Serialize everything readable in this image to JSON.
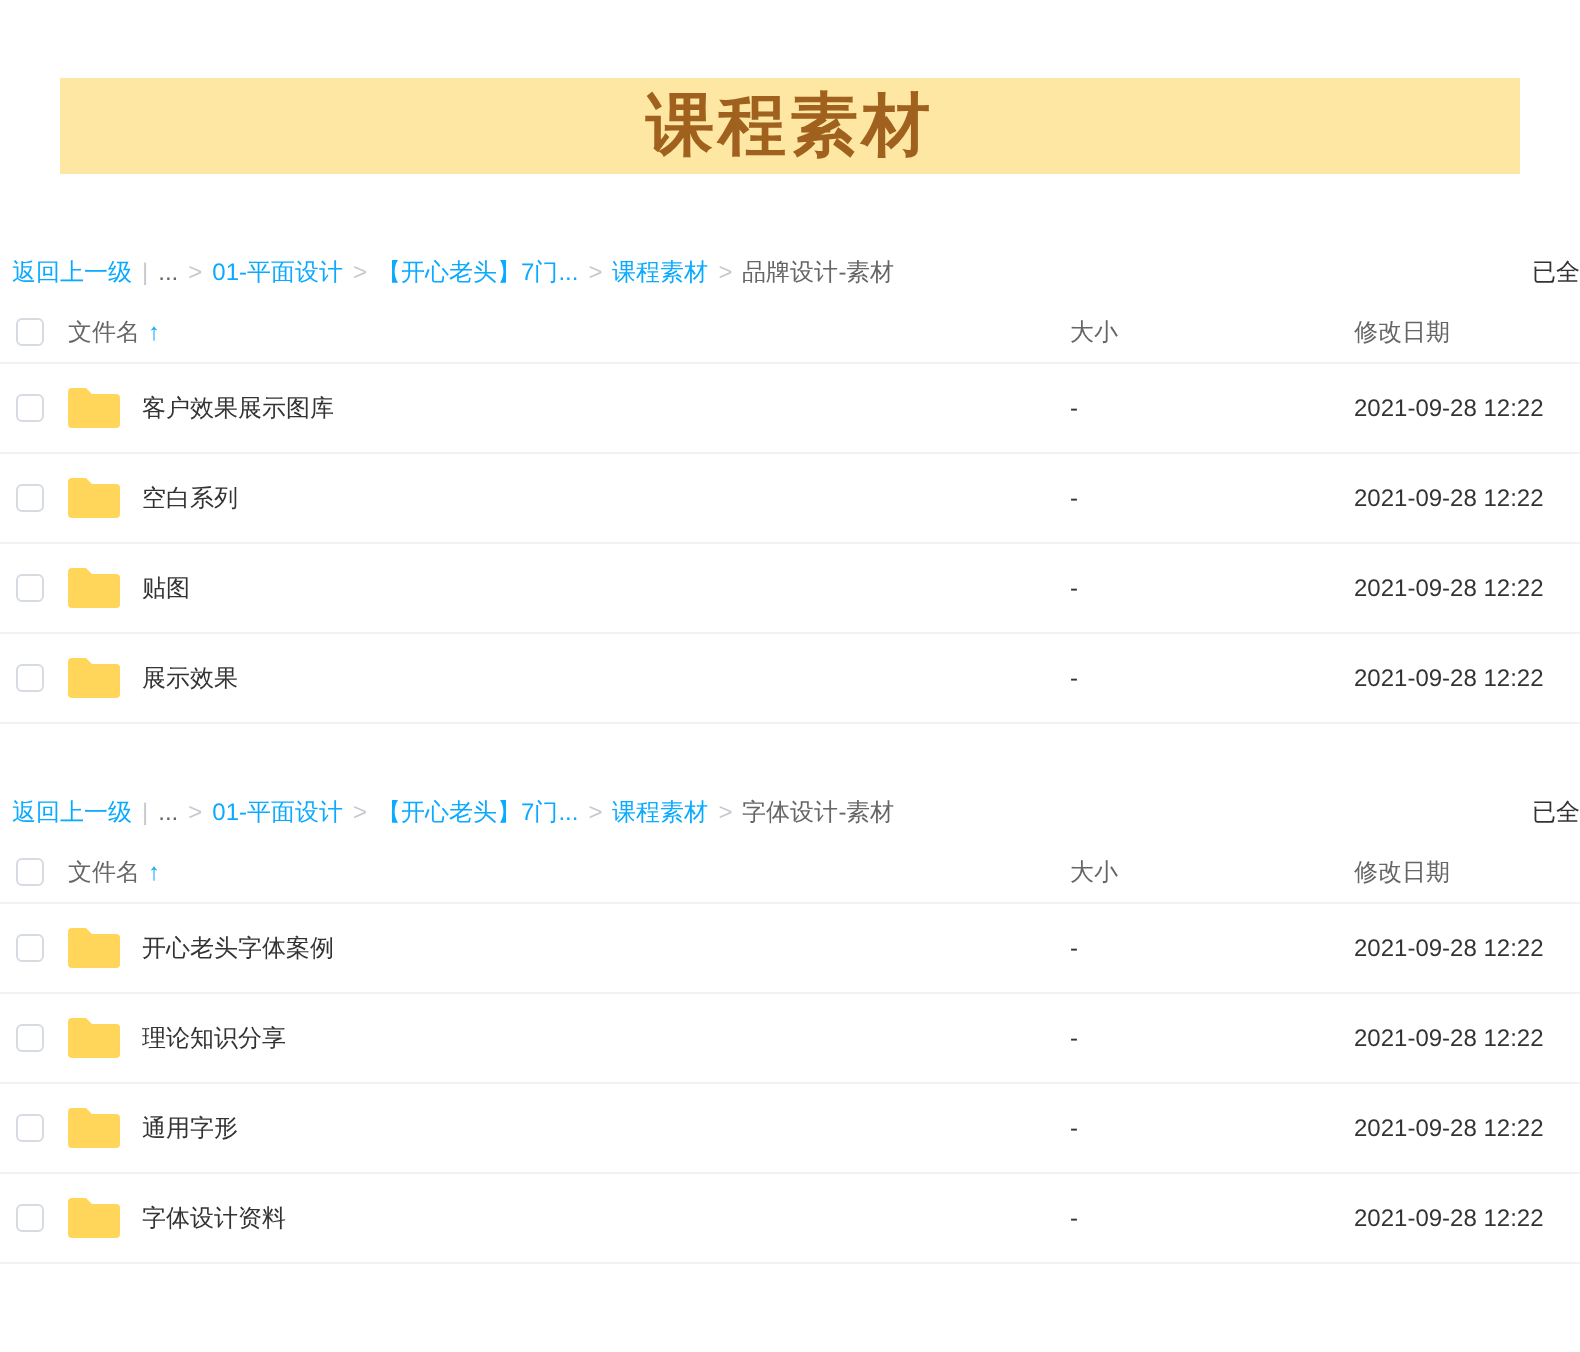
{
  "banner": {
    "title": "课程素材"
  },
  "panels": [
    {
      "breadcrumb": [
        {
          "kind": "link",
          "label": "返回上一级"
        },
        {
          "kind": "separator",
          "label": "|"
        },
        {
          "kind": "text",
          "label": "..."
        },
        {
          "kind": "separator",
          "label": ">"
        },
        {
          "kind": "link",
          "label": "01-平面设计"
        },
        {
          "kind": "separator",
          "label": ">"
        },
        {
          "kind": "link",
          "label": "【开心老头】7门..."
        },
        {
          "kind": "separator",
          "label": ">"
        },
        {
          "kind": "link",
          "label": "课程素材"
        },
        {
          "kind": "separator",
          "label": ">"
        },
        {
          "kind": "text",
          "label": "品牌设计-素材"
        }
      ],
      "right_text": "已全",
      "columns": {
        "name": "文件名",
        "sort_icon": "↑",
        "size": "大小",
        "date": "修改日期"
      },
      "header_checked": false,
      "rows": [
        {
          "name": "客户效果展示图库",
          "size": "-",
          "date": "2021-09-28 12:22",
          "checked": false
        },
        {
          "name": "空白系列",
          "size": "-",
          "date": "2021-09-28 12:22",
          "checked": false
        },
        {
          "name": "贴图",
          "size": "-",
          "date": "2021-09-28 12:22",
          "checked": false
        },
        {
          "name": "展示效果",
          "size": "-",
          "date": "2021-09-28 12:22",
          "checked": false
        }
      ]
    },
    {
      "breadcrumb": [
        {
          "kind": "link",
          "label": "返回上一级"
        },
        {
          "kind": "separator",
          "label": "|"
        },
        {
          "kind": "text",
          "label": "..."
        },
        {
          "kind": "separator",
          "label": ">"
        },
        {
          "kind": "link",
          "label": "01-平面设计"
        },
        {
          "kind": "separator",
          "label": ">"
        },
        {
          "kind": "link",
          "label": "【开心老头】7门..."
        },
        {
          "kind": "separator",
          "label": ">"
        },
        {
          "kind": "link",
          "label": "课程素材"
        },
        {
          "kind": "separator",
          "label": ">"
        },
        {
          "kind": "text",
          "label": "字体设计-素材"
        }
      ],
      "right_text": "已全",
      "columns": {
        "name": "文件名",
        "sort_icon": "↑",
        "size": "大小",
        "date": "修改日期"
      },
      "header_checked": false,
      "rows": [
        {
          "name": "开心老头字体案例",
          "size": "-",
          "date": "2021-09-28 12:22",
          "checked": false
        },
        {
          "name": "理论知识分享",
          "size": "-",
          "date": "2021-09-28 12:22",
          "checked": false
        },
        {
          "name": "通用字形",
          "size": "-",
          "date": "2021-09-28 12:22",
          "checked": false
        },
        {
          "name": "字体设计资料",
          "size": "-",
          "date": "2021-09-28 12:22",
          "checked": false
        }
      ]
    }
  ]
}
